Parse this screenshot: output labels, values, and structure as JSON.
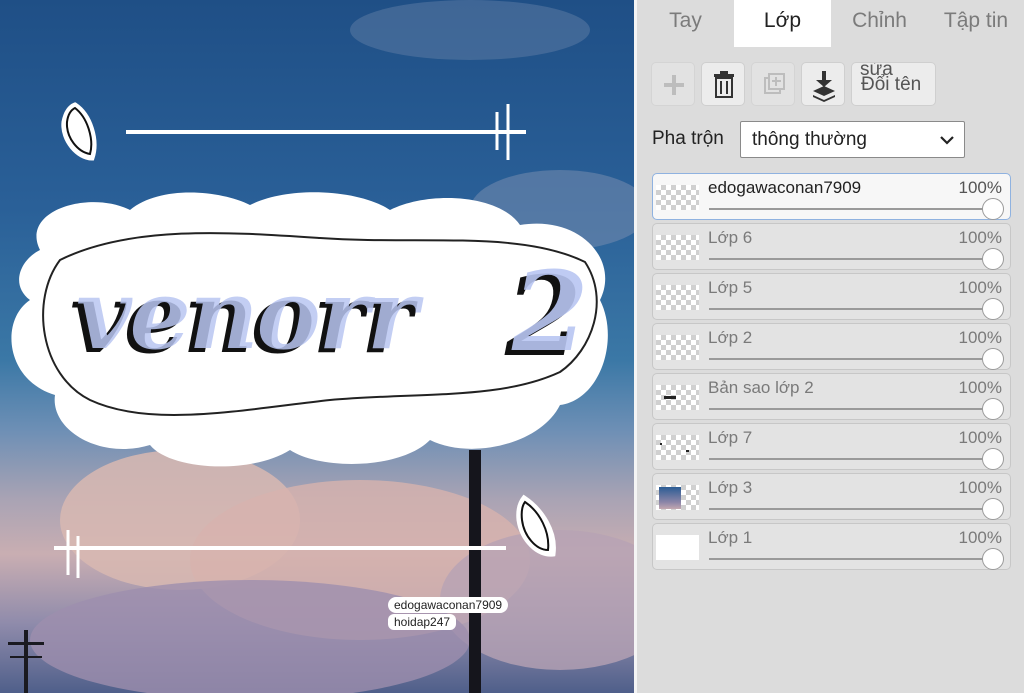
{
  "canvas": {
    "artwork_text": "venom 2",
    "watermark_lines": [
      "edogawaconan7909",
      "hoidap247"
    ]
  },
  "tabs": [
    {
      "label": "Tay"
    },
    {
      "label": "Lớp"
    },
    {
      "label": "Chỉnh"
    },
    {
      "label": "Tập tin"
    }
  ],
  "active_tab": "Lớp",
  "toolbar": {
    "add_icon": "plus-icon",
    "delete_icon": "trash-icon",
    "duplicate_icon": "duplicate-icon",
    "merge_icon": "merge-down-icon",
    "rename_line1": "sửa",
    "rename_line2": "Đổi tên"
  },
  "blend": {
    "label": "Pha trộn",
    "value": "thông thường"
  },
  "layers": [
    {
      "name": "edogawaconan7909",
      "opacity": "100%",
      "selected": true
    },
    {
      "name": "Lớp 6",
      "opacity": "100%"
    },
    {
      "name": "Lớp 5",
      "opacity": "100%"
    },
    {
      "name": "Lớp 2",
      "opacity": "100%"
    },
    {
      "name": "Bản sao lớp 2",
      "opacity": "100%"
    },
    {
      "name": "Lớp 7",
      "opacity": "100%"
    },
    {
      "name": "Lớp 3",
      "opacity": "100%"
    },
    {
      "name": "Lớp 1",
      "opacity": "100%"
    }
  ],
  "colors": {
    "accent_border": "#8fb2e0",
    "lettering_fill": "#b9c6f2"
  }
}
